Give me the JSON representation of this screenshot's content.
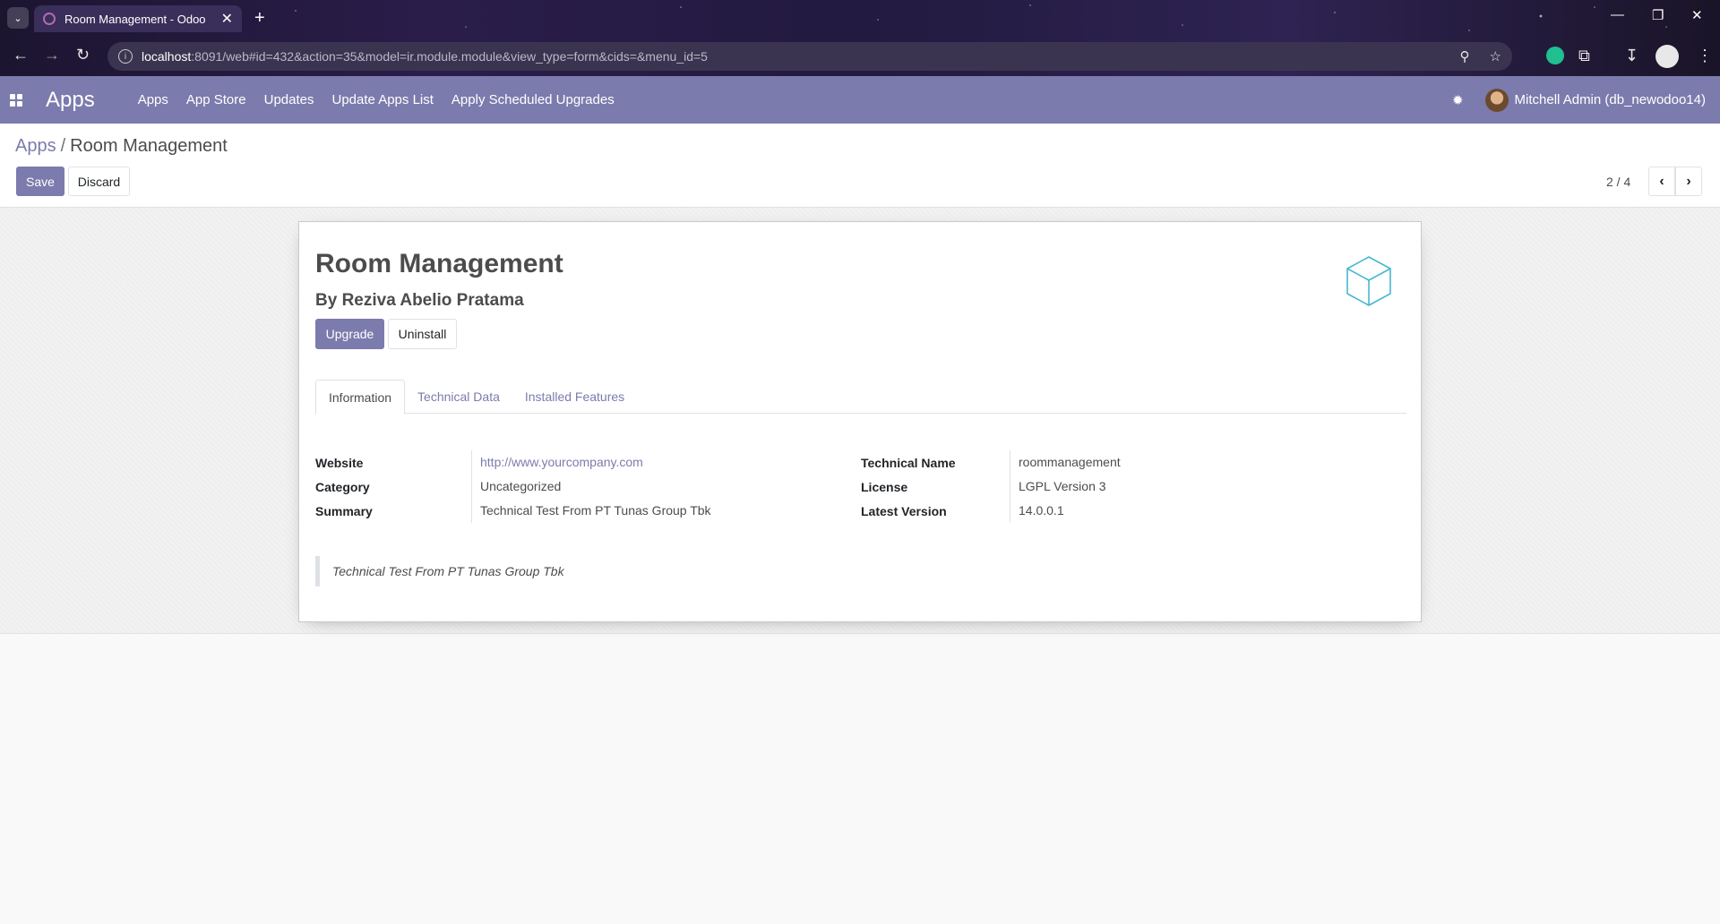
{
  "browser": {
    "tab_title": "Room Management - Odoo",
    "url_host": "localhost",
    "url_rest": ":8091/web#id=432&action=35&model=ir.module.module&view_type=form&cids=&menu_id=5"
  },
  "navbar": {
    "brand": "Apps",
    "menu": [
      "Apps",
      "App Store",
      "Updates",
      "Update Apps List",
      "Apply Scheduled Upgrades"
    ],
    "user": "Mitchell Admin (db_newodoo14)"
  },
  "control_panel": {
    "breadcrumb_parent": "Apps",
    "breadcrumb_separator": "/",
    "breadcrumb_current": "Room Management",
    "save_label": "Save",
    "discard_label": "Discard",
    "pager": "2 / 4"
  },
  "module": {
    "title": "Room Management",
    "author": "By Reziva Abelio Pratama",
    "upgrade_label": "Upgrade",
    "uninstall_label": "Uninstall",
    "tabs": [
      "Information",
      "Technical Data",
      "Installed Features"
    ],
    "fields_left": [
      {
        "label": "Website",
        "value": "http://www.yourcompany.com"
      },
      {
        "label": "Category",
        "value": "Uncategorized"
      },
      {
        "label": "Summary",
        "value": "Technical Test From PT Tunas Group Tbk"
      }
    ],
    "fields_right": [
      {
        "label": "Technical Name",
        "value": "roommanagement"
      },
      {
        "label": "License",
        "value": "LGPL Version 3"
      },
      {
        "label": "Latest Version",
        "value": "14.0.0.1"
      }
    ],
    "description": "Technical Test From PT Tunas Group Tbk"
  },
  "colors": {
    "primary": "#7c7bad",
    "text": "#4c4c4c",
    "module_icon": "#49b7d0"
  }
}
